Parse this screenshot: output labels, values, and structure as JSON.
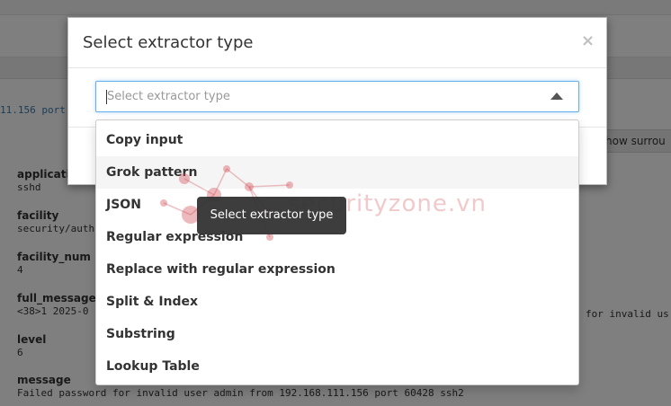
{
  "background": {
    "snippet": "11.156 port",
    "show_button": "how surrou",
    "right_text": "for invalid us",
    "fields": [
      {
        "name": "application",
        "value": "sshd"
      },
      {
        "name": "facility",
        "value": "security/auth"
      },
      {
        "name": "facility_num",
        "value": "4"
      },
      {
        "name": "full_message",
        "value": "<38>1 2025-0"
      },
      {
        "name": "level",
        "value": "6"
      },
      {
        "name": "message",
        "value": "Failed password for invalid user admin from 192.168.111.156 port 60428 ssh2"
      }
    ]
  },
  "modal": {
    "title": "Select extractor type",
    "close_label": "×",
    "select_placeholder": "Select extractor type",
    "options": [
      "Copy input",
      "Grok pattern",
      "JSON",
      "Regular expression",
      "Replace with regular expression",
      "Split & Index",
      "Substring",
      "Lookup Table"
    ],
    "hovered_option_index": 1
  },
  "tooltip": {
    "text": "Select extractor type"
  },
  "watermark": {
    "text": "securityzone.vn"
  },
  "colors": {
    "focus_border": "#66afe9",
    "tooltip_bg": "#333333",
    "option_hover_bg": "#f5f5f5",
    "watermark": "#d23c46"
  }
}
